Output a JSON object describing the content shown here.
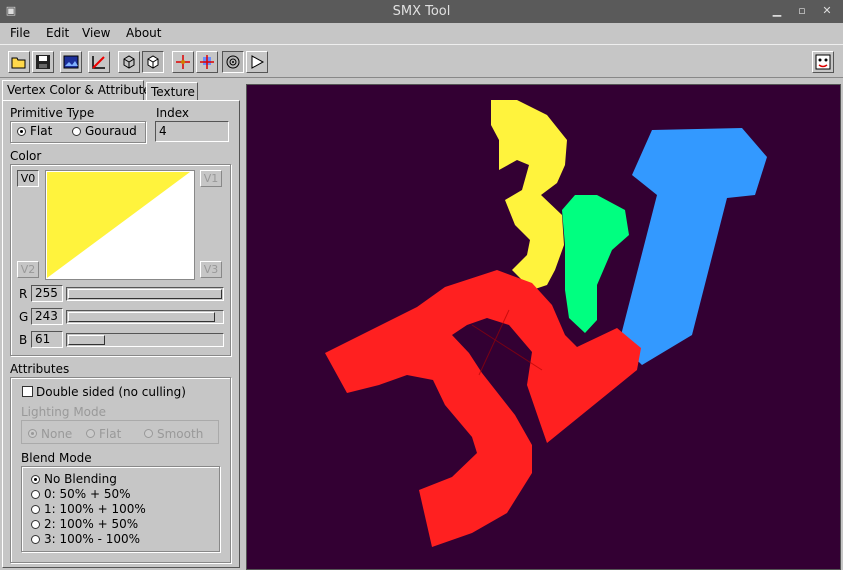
{
  "window": {
    "title": "SMX Tool"
  },
  "menu": {
    "items": [
      "File",
      "Edit",
      "View",
      "About"
    ]
  },
  "toolbar": {
    "buttons": [
      "open-folder-icon",
      "save-icon",
      "image-icon",
      "angle-icon",
      "cube-wire-icon",
      "cube-solid-icon",
      "move-icon",
      "color-axis-icon",
      "target-icon",
      "play-icon"
    ],
    "right_button": "face-icon"
  },
  "tabs": {
    "vertex": "Vertex Color & Attributes",
    "texture": "Texture"
  },
  "primitive": {
    "label": "Primitive Type",
    "options": [
      "Flat",
      "Gouraud"
    ],
    "selected": "Flat",
    "index_label": "Index",
    "index_value": "4"
  },
  "color": {
    "label": "Color",
    "v0": "V0",
    "v1": "V1",
    "v2": "V2",
    "v3": "V3",
    "swatch": "#fff33d",
    "r_label": "R",
    "r_value": "255",
    "g_label": "G",
    "g_value": "243",
    "b_label": "B",
    "b_value": "61",
    "r_fraction": 1.0,
    "g_fraction": 0.953,
    "b_fraction": 0.239
  },
  "attributes": {
    "label": "Attributes",
    "double_sided": "Double sided (no culling)",
    "lighting_label": "Lighting Mode",
    "lighting_options": [
      "None",
      "Flat",
      "Smooth"
    ],
    "lighting_selected": "None",
    "blend_label": "Blend Mode",
    "blend_options": [
      "No Blending",
      "0: 50% + 50%",
      "1: 100% + 100%",
      "2: 100% + 50%",
      "3: 100% - 100%"
    ],
    "blend_selected": "No Blending"
  },
  "viewport": {
    "background": "#330033",
    "colors": {
      "red": "#ff2020",
      "yellow": "#fff33d",
      "green": "#00ff80",
      "blue": "#3399ff"
    }
  }
}
